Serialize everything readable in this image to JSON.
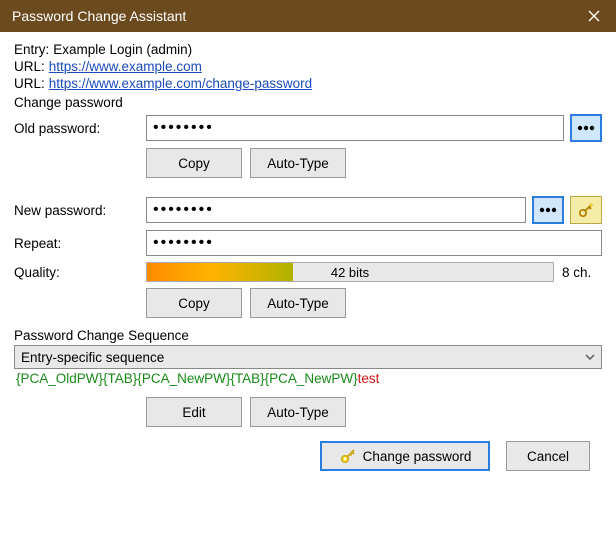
{
  "window": {
    "title": "Password Change Assistant"
  },
  "entry": {
    "label": "Entry:",
    "value": "Example Login (admin)"
  },
  "url1": {
    "label": "URL:",
    "href": "https://www.example.com"
  },
  "url2": {
    "label": "URL:",
    "href": "https://www.example.com/change-password"
  },
  "section": {
    "change_password": "Change password"
  },
  "old_password": {
    "label": "Old password:",
    "value": "••••••••",
    "copy": "Copy",
    "autotype": "Auto-Type"
  },
  "new_password": {
    "label": "New password:",
    "value": "••••••••"
  },
  "repeat": {
    "label": "Repeat:",
    "value": "••••••••"
  },
  "quality": {
    "label": "Quality:",
    "bits": "42 bits",
    "chars": "8 ch.",
    "copy": "Copy",
    "autotype": "Auto-Type"
  },
  "sequence": {
    "header": "Password Change Sequence",
    "dropdown": "Entry-specific sequence",
    "seq_main": "{PCA_OldPW}{TAB}{PCA_NewPW}{TAB}{PCA_NewPW}",
    "seq_tail": "test",
    "edit": "Edit",
    "autotype": "Auto-Type"
  },
  "footer": {
    "change": "Change password",
    "cancel": "Cancel"
  },
  "icons": {
    "dots": "dots-icon",
    "keygen": "key-sparkle-icon",
    "close": "close-icon",
    "chevron": "chevron-down-icon",
    "key": "key-icon"
  }
}
